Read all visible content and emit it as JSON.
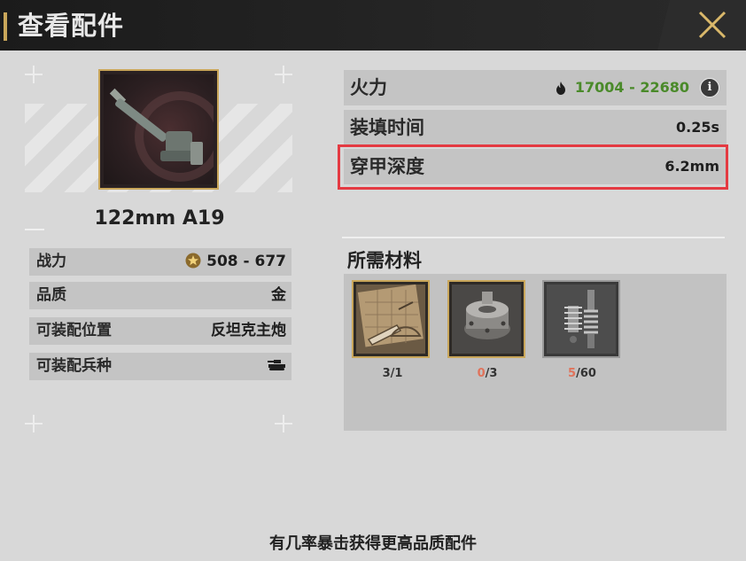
{
  "header": {
    "title": "查看配件"
  },
  "item": {
    "name": "122mm A19"
  },
  "stats": [
    {
      "label": "战力",
      "value": "508 - 677",
      "icon": "rank-badge-icon"
    },
    {
      "label": "品质",
      "value": "金"
    },
    {
      "label": "可装配位置",
      "value": "反坦克主炮"
    },
    {
      "label": "可装配兵种",
      "value": "",
      "icon": "tank-icon"
    }
  ],
  "attributes": [
    {
      "label": "火力",
      "value": "17004 - 22680",
      "value_color": "#4a8a2a",
      "icon": "fire-icon",
      "info": "i"
    },
    {
      "label": "装填时间",
      "value": "0.25s"
    },
    {
      "label": "穿甲深度",
      "value": "6.2mm"
    }
  ],
  "materials": {
    "title": "所需材料",
    "items": [
      {
        "name": "blueprint-material",
        "have": "3",
        "need": "1",
        "short": false
      },
      {
        "name": "gear-housing-material",
        "have": "0",
        "need": "3",
        "short": true
      },
      {
        "name": "spring-part-material",
        "have": "5",
        "need": "60",
        "short": true
      }
    ]
  },
  "footer": {
    "text": "有几率暴击获得更高品质配件"
  },
  "colors": {
    "gold": "#c9a65a",
    "highlight": "#e43a42",
    "short_count": "#e0735b",
    "fire_value": "#4a8a2a"
  }
}
